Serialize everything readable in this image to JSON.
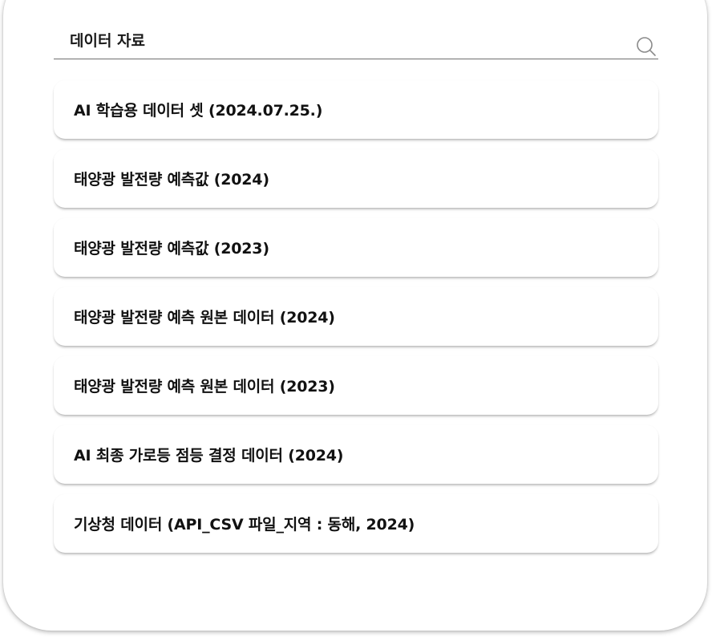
{
  "search": {
    "value": "데이터 자료",
    "icon": "search-icon"
  },
  "items": [
    {
      "label": "AI 학습용 데이터 셋 (2024.07.25.)"
    },
    {
      "label": "태양광 발전량 예측값 (2024)"
    },
    {
      "label": "태양광 발전량 예측값 (2023)"
    },
    {
      "label": "태양광 발전량 예측 원본 데이터 (2024)"
    },
    {
      "label": "태양광 발전량 예측 원본 데이터 (2023)"
    },
    {
      "label": "AI 최종 가로등 점등 결정 데이터 (2024)"
    },
    {
      "label": "기상청 데이터 (API_CSV 파일_지역 :  동해, 2024)"
    }
  ]
}
